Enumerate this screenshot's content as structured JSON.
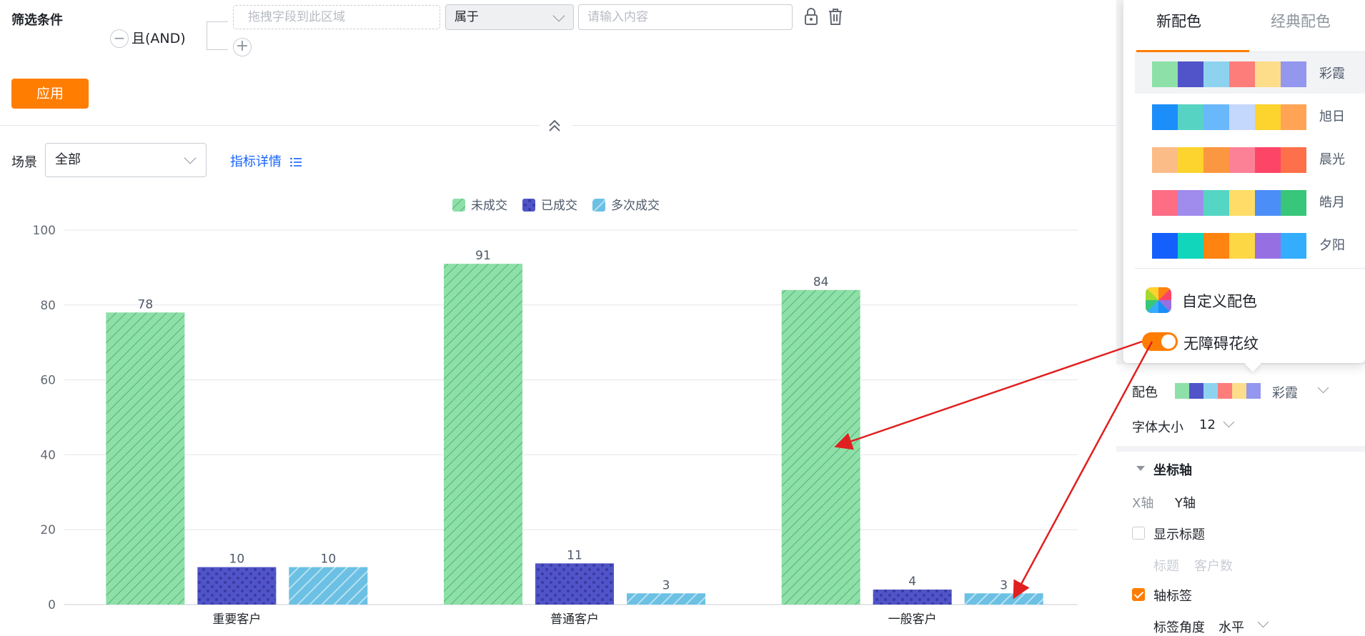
{
  "filter": {
    "title": "筛选条件",
    "logic_label": "且(AND)",
    "drop_placeholder": "拖拽字段到此区域",
    "operator": "属于",
    "value_placeholder": "请输入内容",
    "apply_label": "应用"
  },
  "toolbar": {
    "scene_label": "场景",
    "scene_value": "全部",
    "metric_link": "指标详情"
  },
  "chart_data": {
    "type": "bar",
    "categories": [
      "重要客户",
      "普通客户",
      "一般客户"
    ],
    "series": [
      {
        "name": "未成交",
        "values": [
          78,
          91,
          84
        ],
        "color": "#8de0a7",
        "pattern": "diagonal-stripes"
      },
      {
        "name": "已成交",
        "values": [
          10,
          11,
          4
        ],
        "color": "#5054c8",
        "pattern": "dots"
      },
      {
        "name": "多次成交",
        "values": [
          10,
          3,
          3
        ],
        "color": "#6bc0e3",
        "pattern": "wide-diagonal-stripes"
      }
    ],
    "ylim": [
      0,
      100
    ],
    "yticks": [
      0,
      20,
      40,
      60,
      80,
      100
    ],
    "grid": true,
    "legend_position": "top-center",
    "data_labels": true
  },
  "color_panel": {
    "tabs": [
      "新配色",
      "经典配色"
    ],
    "active_tab": "新配色",
    "palettes": [
      {
        "name": "彩霞",
        "active": true,
        "colors": [
          "#8de0a7",
          "#5054c8",
          "#8dd3f0",
          "#fd7d7b",
          "#fddd8a",
          "#9397ee"
        ]
      },
      {
        "name": "旭日",
        "active": false,
        "colors": [
          "#1c8ef9",
          "#57d3c4",
          "#6ab8fc",
          "#c4d7fd",
          "#fdd32d",
          "#fea454"
        ]
      },
      {
        "name": "晨光",
        "active": false,
        "colors": [
          "#fcbc87",
          "#fdd32d",
          "#fc9741",
          "#fc8197",
          "#fd4568",
          "#fe7049"
        ]
      },
      {
        "name": "皓月",
        "active": false,
        "colors": [
          "#fd6d84",
          "#a08cec",
          "#55d5c4",
          "#fedc67",
          "#4c8ef7",
          "#37c67a"
        ]
      },
      {
        "name": "夕阳",
        "active": false,
        "colors": [
          "#1560fc",
          "#12d6bc",
          "#fe8310",
          "#fed745",
          "#9670e3",
          "#33adfc"
        ]
      }
    ],
    "custom_label": "自定义配色",
    "accessible_label": "无障碍花纹",
    "accessible_on": true
  },
  "settings": {
    "color_label": "配色",
    "color_value": "彩霞",
    "font_label": "字体大小",
    "font_value": "12",
    "axis_section": "坐标轴",
    "axis_x": "X轴",
    "axis_y": "Y轴",
    "show_title_label": "显示标题",
    "show_title_checked": false,
    "title_label": "标题",
    "title_value": "客户数",
    "axis_label_label": "轴标签",
    "axis_label_checked": true,
    "label_angle_label": "标签角度",
    "label_angle_value": "水平"
  },
  "colors": {
    "accent": "#ff7d00",
    "link": "#1664ff",
    "annotation_arrow": "#e02020"
  }
}
